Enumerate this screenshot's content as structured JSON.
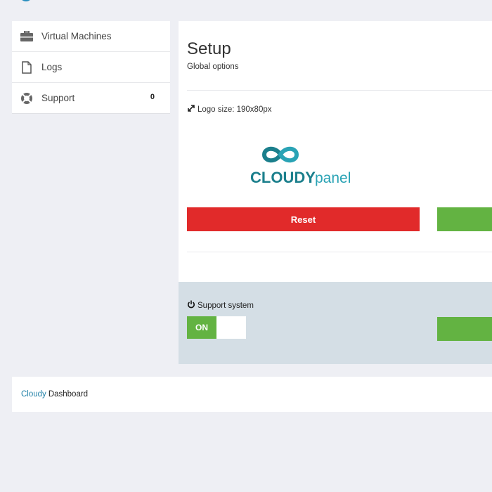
{
  "sidebar": {
    "items": [
      {
        "label": "Virtual Machines",
        "icon": "briefcase-icon"
      },
      {
        "label": "Logs",
        "icon": "document-icon"
      },
      {
        "label": "Support",
        "icon": "lifebuoy-icon",
        "badge": "0"
      }
    ]
  },
  "main": {
    "title": "Setup",
    "subtitle": "Global options",
    "logo_size_label": "Logo size: 190x80px",
    "logo": {
      "word_bold": "CLOUDY",
      "word_light": "panel",
      "color_dark": "#1b7f8c",
      "color_light": "#2aa3b5"
    },
    "reset_label": "Reset",
    "support_label": "Support system",
    "toggle_on_label": "ON"
  },
  "footer": {
    "brand": "Cloudy",
    "text": "Dashboard"
  },
  "colors": {
    "reset": "#e12a2a",
    "save": "#63b342",
    "support_bg": "#d4dee5",
    "page_bg": "#eeeff4"
  }
}
